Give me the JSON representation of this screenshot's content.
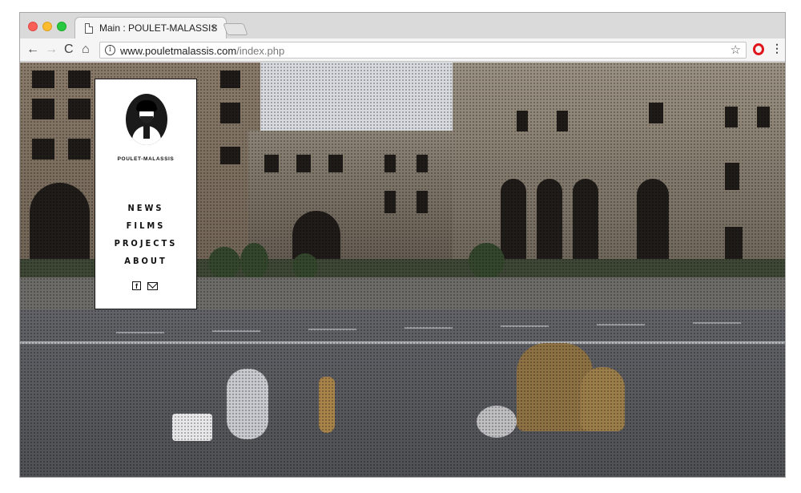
{
  "browser": {
    "tab_title": "Main : POULET-MALASSIS",
    "tab_close": "×",
    "url_host": "www.pouletmalassis.com",
    "url_path": "/index.php",
    "info_glyph": "i",
    "back_glyph": "←",
    "forward_glyph": "→",
    "reload_glyph": "C",
    "home_glyph": "⌂",
    "star_glyph": "☆",
    "menu_glyph": "⋮"
  },
  "site": {
    "brand": "POULET-MALASSIS",
    "nav": [
      {
        "label": "NEWS"
      },
      {
        "label": "FILMS"
      },
      {
        "label": "PROJECTS"
      },
      {
        "label": "ABOUT"
      }
    ],
    "social": {
      "facebook_glyph": "f",
      "icons": [
        "facebook-icon",
        "mail-icon"
      ]
    }
  },
  "colors": {
    "panel_bg": "#ffffff",
    "panel_text": "#111111",
    "opera_red": "#e0161c"
  }
}
